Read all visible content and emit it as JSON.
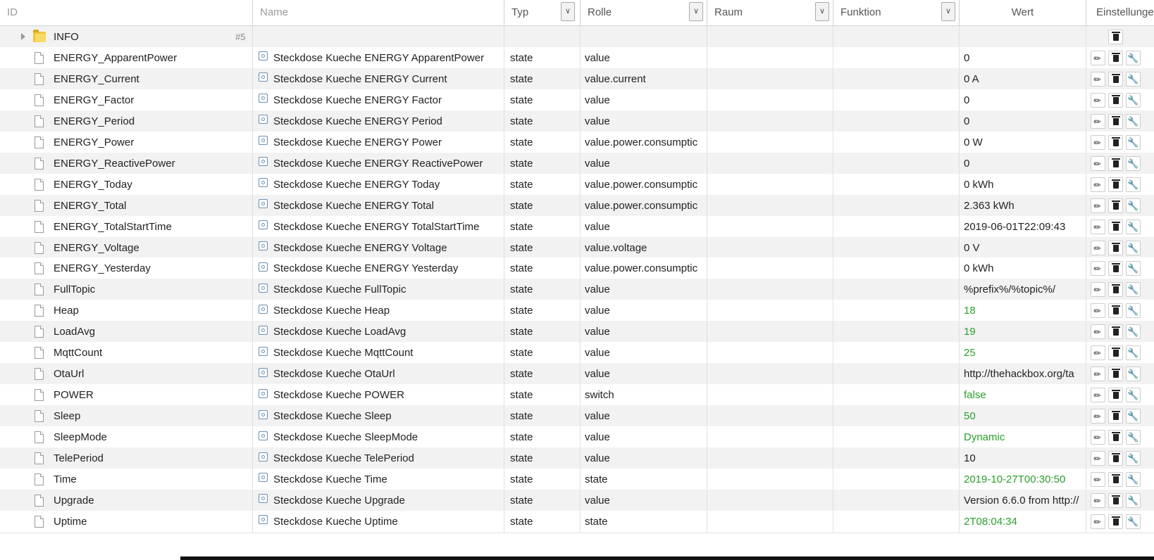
{
  "header": {
    "id": "ID",
    "name": "Name",
    "typ": "Typ",
    "rolle": "Rolle",
    "raum": "Raum",
    "funktion": "Funktion",
    "wert": "Wert",
    "einstellungen": "Einstellungen"
  },
  "folder": {
    "id": "INFO",
    "count": "#5"
  },
  "rows": [
    {
      "id": "ENERGY_ApparentPower",
      "name": "Steckdose Kueche ENERGY ApparentPower",
      "typ": "state",
      "rolle": "value",
      "wert": "0",
      "green": false
    },
    {
      "id": "ENERGY_Current",
      "name": "Steckdose Kueche ENERGY Current",
      "typ": "state",
      "rolle": "value.current",
      "wert": "0 A",
      "green": false
    },
    {
      "id": "ENERGY_Factor",
      "name": "Steckdose Kueche ENERGY Factor",
      "typ": "state",
      "rolle": "value",
      "wert": "0",
      "green": false
    },
    {
      "id": "ENERGY_Period",
      "name": "Steckdose Kueche ENERGY Period",
      "typ": "state",
      "rolle": "value",
      "wert": "0",
      "green": false
    },
    {
      "id": "ENERGY_Power",
      "name": "Steckdose Kueche ENERGY Power",
      "typ": "state",
      "rolle": "value.power.consumptic",
      "wert": "0 W",
      "green": false
    },
    {
      "id": "ENERGY_ReactivePower",
      "name": "Steckdose Kueche ENERGY ReactivePower",
      "typ": "state",
      "rolle": "value",
      "wert": "0",
      "green": false
    },
    {
      "id": "ENERGY_Today",
      "name": "Steckdose Kueche ENERGY Today",
      "typ": "state",
      "rolle": "value.power.consumptic",
      "wert": "0 kWh",
      "green": false
    },
    {
      "id": "ENERGY_Total",
      "name": "Steckdose Kueche ENERGY Total",
      "typ": "state",
      "rolle": "value.power.consumptic",
      "wert": "2.363 kWh",
      "green": false
    },
    {
      "id": "ENERGY_TotalStartTime",
      "name": "Steckdose Kueche ENERGY TotalStartTime",
      "typ": "state",
      "rolle": "value",
      "wert": "2019-06-01T22:09:43",
      "green": false
    },
    {
      "id": "ENERGY_Voltage",
      "name": "Steckdose Kueche ENERGY Voltage",
      "typ": "state",
      "rolle": "value.voltage",
      "wert": "0 V",
      "green": false
    },
    {
      "id": "ENERGY_Yesterday",
      "name": "Steckdose Kueche ENERGY Yesterday",
      "typ": "state",
      "rolle": "value.power.consumptic",
      "wert": "0 kWh",
      "green": false
    },
    {
      "id": "FullTopic",
      "name": "Steckdose Kueche FullTopic",
      "typ": "state",
      "rolle": "value",
      "wert": "%prefix%/%topic%/",
      "green": false
    },
    {
      "id": "Heap",
      "name": "Steckdose Kueche Heap",
      "typ": "state",
      "rolle": "value",
      "wert": "18",
      "green": true
    },
    {
      "id": "LoadAvg",
      "name": "Steckdose Kueche LoadAvg",
      "typ": "state",
      "rolle": "value",
      "wert": "19",
      "green": true
    },
    {
      "id": "MqttCount",
      "name": "Steckdose Kueche MqttCount",
      "typ": "state",
      "rolle": "value",
      "wert": "25",
      "green": true
    },
    {
      "id": "OtaUrl",
      "name": "Steckdose Kueche OtaUrl",
      "typ": "state",
      "rolle": "value",
      "wert": "http://thehackbox.org/ta",
      "green": false
    },
    {
      "id": "POWER",
      "name": "Steckdose Kueche POWER",
      "typ": "state",
      "rolle": "switch",
      "wert": "false",
      "green": true
    },
    {
      "id": "Sleep",
      "name": "Steckdose Kueche Sleep",
      "typ": "state",
      "rolle": "value",
      "wert": "50",
      "green": true
    },
    {
      "id": "SleepMode",
      "name": "Steckdose Kueche SleepMode",
      "typ": "state",
      "rolle": "value",
      "wert": "Dynamic",
      "green": true
    },
    {
      "id": "TelePeriod",
      "name": "Steckdose Kueche TelePeriod",
      "typ": "state",
      "rolle": "value",
      "wert": "10",
      "green": false
    },
    {
      "id": "Time",
      "name": "Steckdose Kueche Time",
      "typ": "state",
      "rolle": "state",
      "wert": "2019-10-27T00:30:50",
      "green": true
    },
    {
      "id": "Upgrade",
      "name": "Steckdose Kueche Upgrade",
      "typ": "state",
      "rolle": "value",
      "wert": "Version 6.6.0 from http://",
      "green": false
    },
    {
      "id": "Uptime",
      "name": "Steckdose Kueche Uptime",
      "typ": "state",
      "rolle": "state",
      "wert": "2T08:04:34",
      "green": true
    }
  ],
  "colors": {
    "green_value": "#2aa02a",
    "stripe": "#f2f2f2"
  },
  "icons": {
    "edit": "pencil-icon",
    "delete": "trash-icon",
    "settings": "wrench-icon",
    "filter": "chevron-down-icon"
  }
}
